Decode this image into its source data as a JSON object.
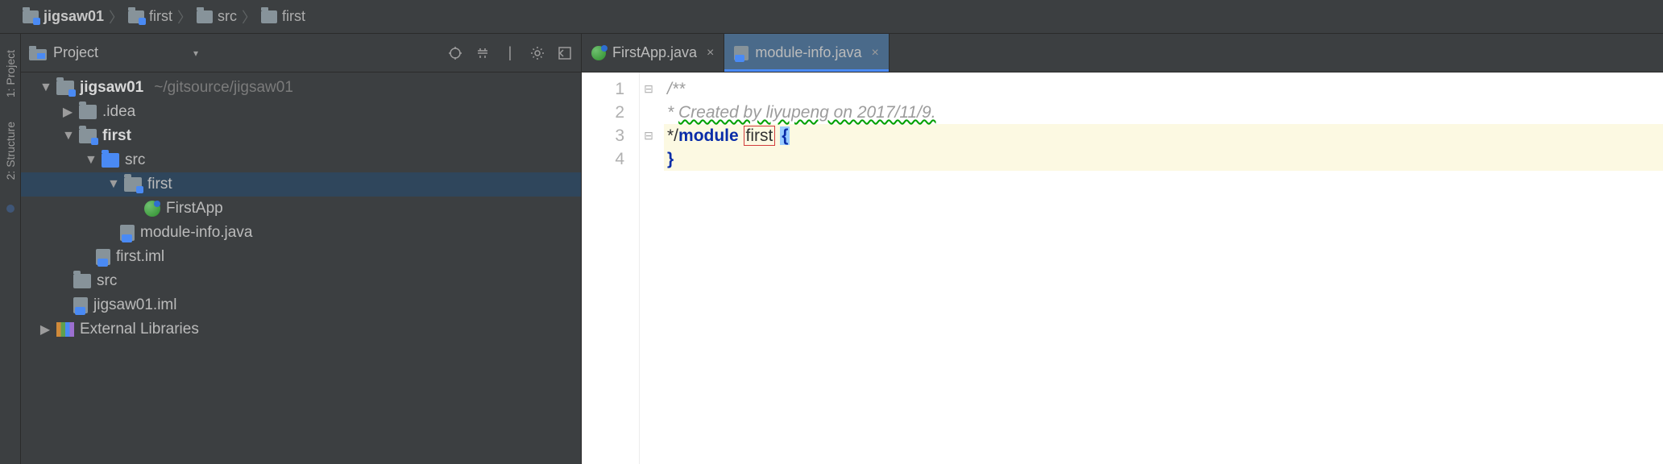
{
  "breadcrumb": [
    {
      "label": "jigsaw01",
      "bold": true
    },
    {
      "label": "first"
    },
    {
      "label": "src"
    },
    {
      "label": "first"
    }
  ],
  "panel": {
    "title": "Project"
  },
  "tree": {
    "root": {
      "name": "jigsaw01",
      "hint": "~/gitsource/jigsaw01"
    },
    "idea": ".idea",
    "firstMod": "first",
    "firstSrc": "src",
    "firstPkg": "first",
    "firstApp": "FirstApp",
    "modInfo": "module-info.java",
    "firstIml": "first.iml",
    "srcTop": "src",
    "rootIml": "jigsaw01.iml",
    "extLibs": "External Libraries"
  },
  "tabs": [
    {
      "label": "FirstApp.java",
      "kind": "java",
      "active": false
    },
    {
      "label": "module-info.java",
      "kind": "jfile",
      "active": true
    }
  ],
  "code": {
    "l1": "/**",
    "l2_prefix": " * ",
    "l2_text": "Created by liyupeng on 2017/11/9.",
    "l3_prefix": " */",
    "l3_kw": "module",
    "l3_name": "first",
    "l3_brace": "{",
    "l4": "}"
  },
  "rail": {
    "project": "1: Project",
    "structure": "2: Structure"
  }
}
